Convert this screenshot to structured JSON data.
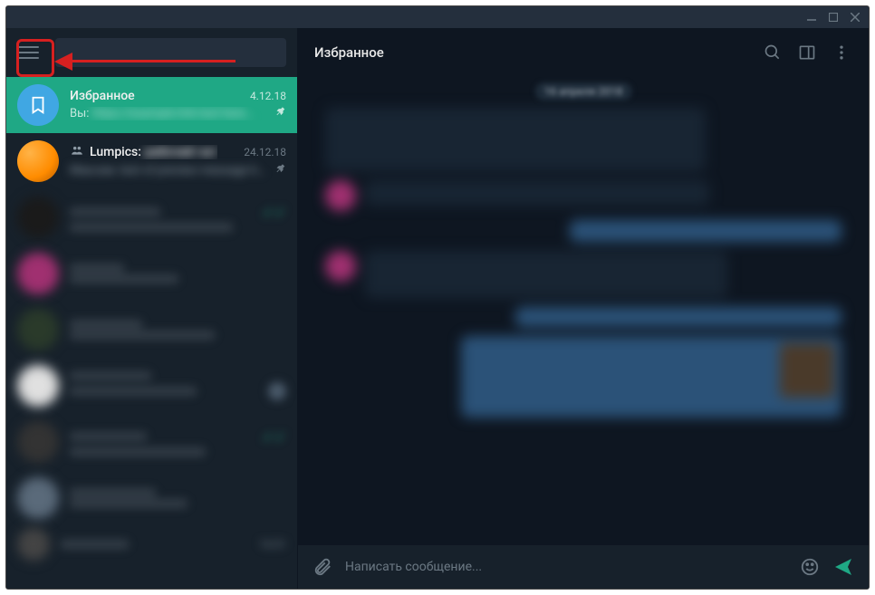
{
  "header": {
    "title": "Избранное"
  },
  "search": {
    "placeholder": ""
  },
  "chats": [
    {
      "name": "Избранное",
      "preview": "Вы:",
      "date": "4.12.18",
      "pinned": true,
      "type": "saved"
    },
    {
      "name": "Lumpics:",
      "preview": "",
      "date": "24.12.18",
      "pinned": true,
      "type": "group"
    }
  ],
  "compose": {
    "placeholder": "Написать сообщение..."
  },
  "date_separator": "16 апреля 2018",
  "blurred_time": "16:01",
  "icons": {
    "menu": "hamburger-icon",
    "search": "search-icon",
    "sidebar_toggle": "sidebar-panel-icon",
    "more": "more-vertical-icon",
    "attach": "paperclip-icon",
    "emoji": "smile-icon",
    "send": "send-icon",
    "bookmark": "bookmark-icon",
    "pin": "pin-icon",
    "group": "group-icon"
  }
}
